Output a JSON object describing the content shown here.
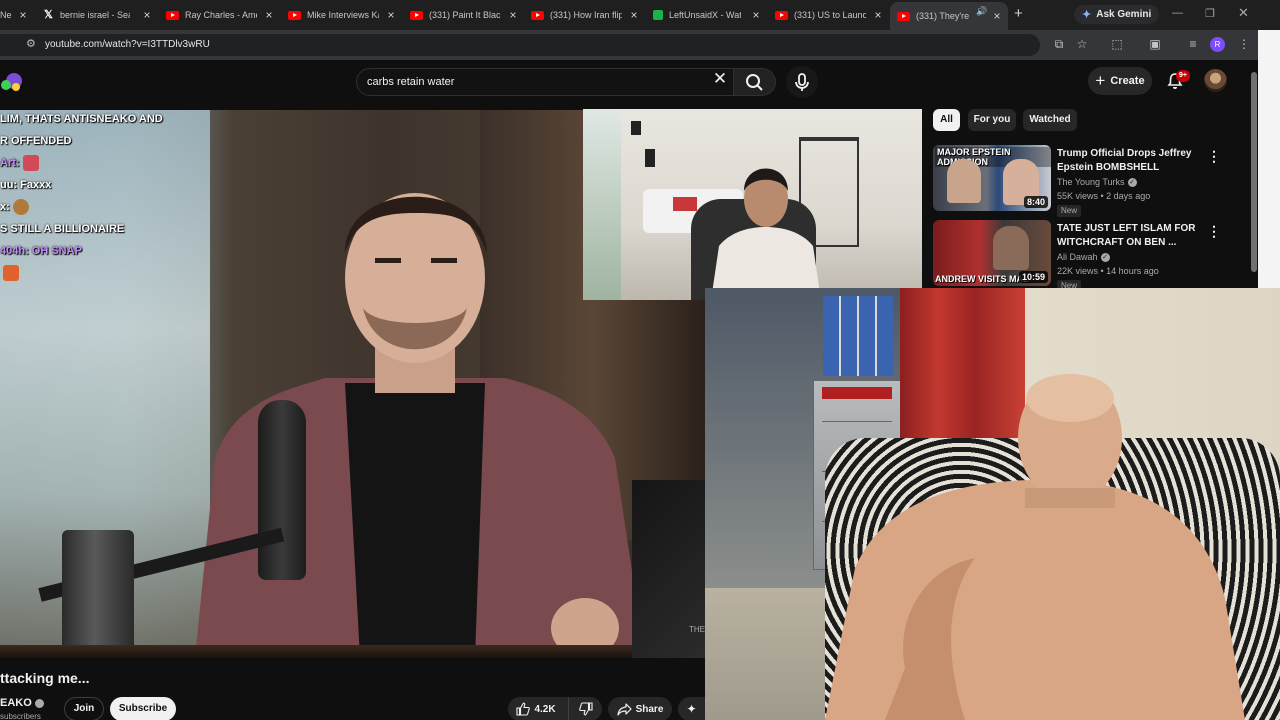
{
  "browser": {
    "tabs": [
      {
        "label": "Ne",
        "icon": "generic-icon"
      },
      {
        "label": "bernie israel - Sear",
        "icon": "x-icon"
      },
      {
        "label": "Ray Charles - Ame",
        "icon": "youtube-icon"
      },
      {
        "label": "Mike Interviews Ka",
        "icon": "youtube-icon"
      },
      {
        "label": "(331) Paint It Black",
        "icon": "youtube-icon"
      },
      {
        "label": "(331) How Iran flip",
        "icon": "youtube-icon"
      },
      {
        "label": "LeftUnsaidX - Wate",
        "icon": "leftunsaid-icon"
      },
      {
        "label": "(331) US to Launch",
        "icon": "youtube-icon"
      },
      {
        "label": "(331) They're a",
        "icon": "youtube-icon"
      }
    ],
    "ask_gemini": "Ask Gemini",
    "url": "youtube.com/watch?v=I3TTDlv3wRU"
  },
  "youtube": {
    "search_value": "carbs retain water",
    "create_label": "Create",
    "notifications_badge": "9+"
  },
  "video": {
    "chat": [
      "LIM, THATS ANTISNEAKO AND",
      "R OFFENDED",
      "Art:",
      "uu: Faxxx",
      "x:",
      "S STILL A BILLIONAIRE",
      "404h: OH SNAP",
      ""
    ],
    "watermark": "THE",
    "title": "ttacking me...",
    "channel": "EAKO",
    "subscribers": "subscribers",
    "join_label": "Join",
    "subscribe_label": "Subscribe",
    "likes": "4.2K",
    "share_label": "Share"
  },
  "recommendations": {
    "chips": [
      "All",
      "For you",
      "Watched"
    ],
    "items": [
      {
        "thumb_caption": "MAJOR EPSTEIN ADMISSION",
        "duration": "8:40",
        "title": "Trump Official Drops Jeffrey Epstein BOMBSHELL",
        "channel": "The Young Turks",
        "meta": "55K views • 2 days ago",
        "badge": "New"
      },
      {
        "thumb_caption": "ANDREW VISITS MAL",
        "duration": "10:59",
        "title": "TATE JUST LEFT ISLAM FOR WITCHCRAFT ON BEN ...",
        "channel": "Ali Dawah",
        "meta": "22K views • 14 hours ago",
        "badge": "New"
      }
    ]
  },
  "colors": {
    "youtube_red": "#ff0000",
    "background": "#0f0f0f",
    "chip_active": "#f1f1f1"
  }
}
